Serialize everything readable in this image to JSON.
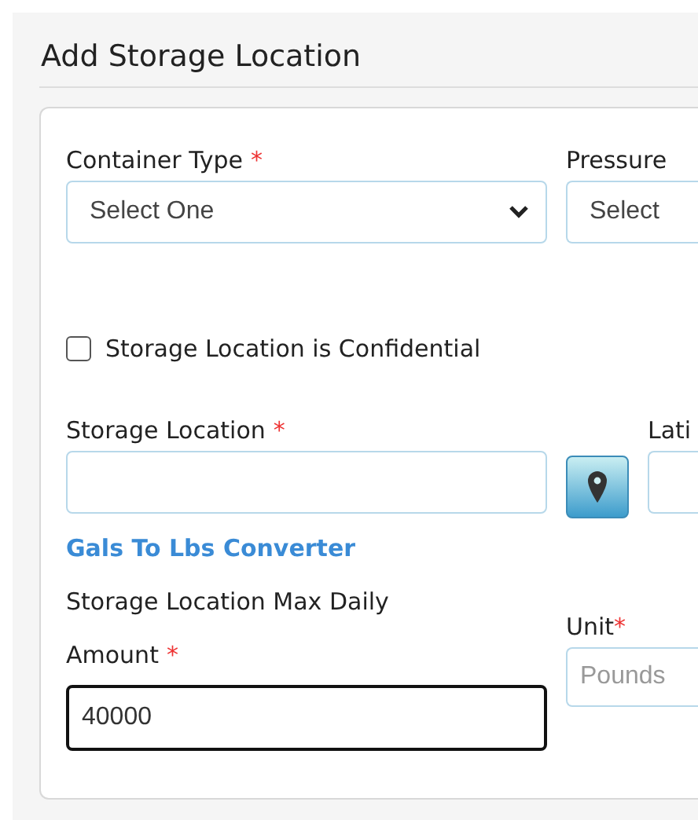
{
  "title": "Add Storage Location",
  "rows": [
    {
      "kind": "pair",
      "fields": [
        {
          "label": "Container Type",
          "marker": "*",
          "kind": "select",
          "value": "Select One"
        },
        {
          "label": "Pressure",
          "kind": "select",
          "value": "Select"
        }
      ]
    },
    {
      "kind": "checkbox",
      "label": "Storage Location is Confidential",
      "checked": false
    },
    {
      "kind": "location",
      "fields": [
        {
          "label": "Storage Location",
          "marker": "*",
          "kind": "text"
        },
        {
          "label": "Lati",
          "kind": "text"
        }
      ]
    },
    {
      "kind": "link",
      "label": "Gals To Lbs Converter"
    },
    {
      "kind": "amount",
      "fields": [
        {
          "label": "Storage Location Max Daily Amount",
          "marker": "*",
          "kind": "text",
          "value": "40000",
          "focused": true
        },
        {
          "label": "Unit",
          "marker": "*",
          "kind": "text",
          "placeholder": "Pounds"
        }
      ]
    }
  ]
}
